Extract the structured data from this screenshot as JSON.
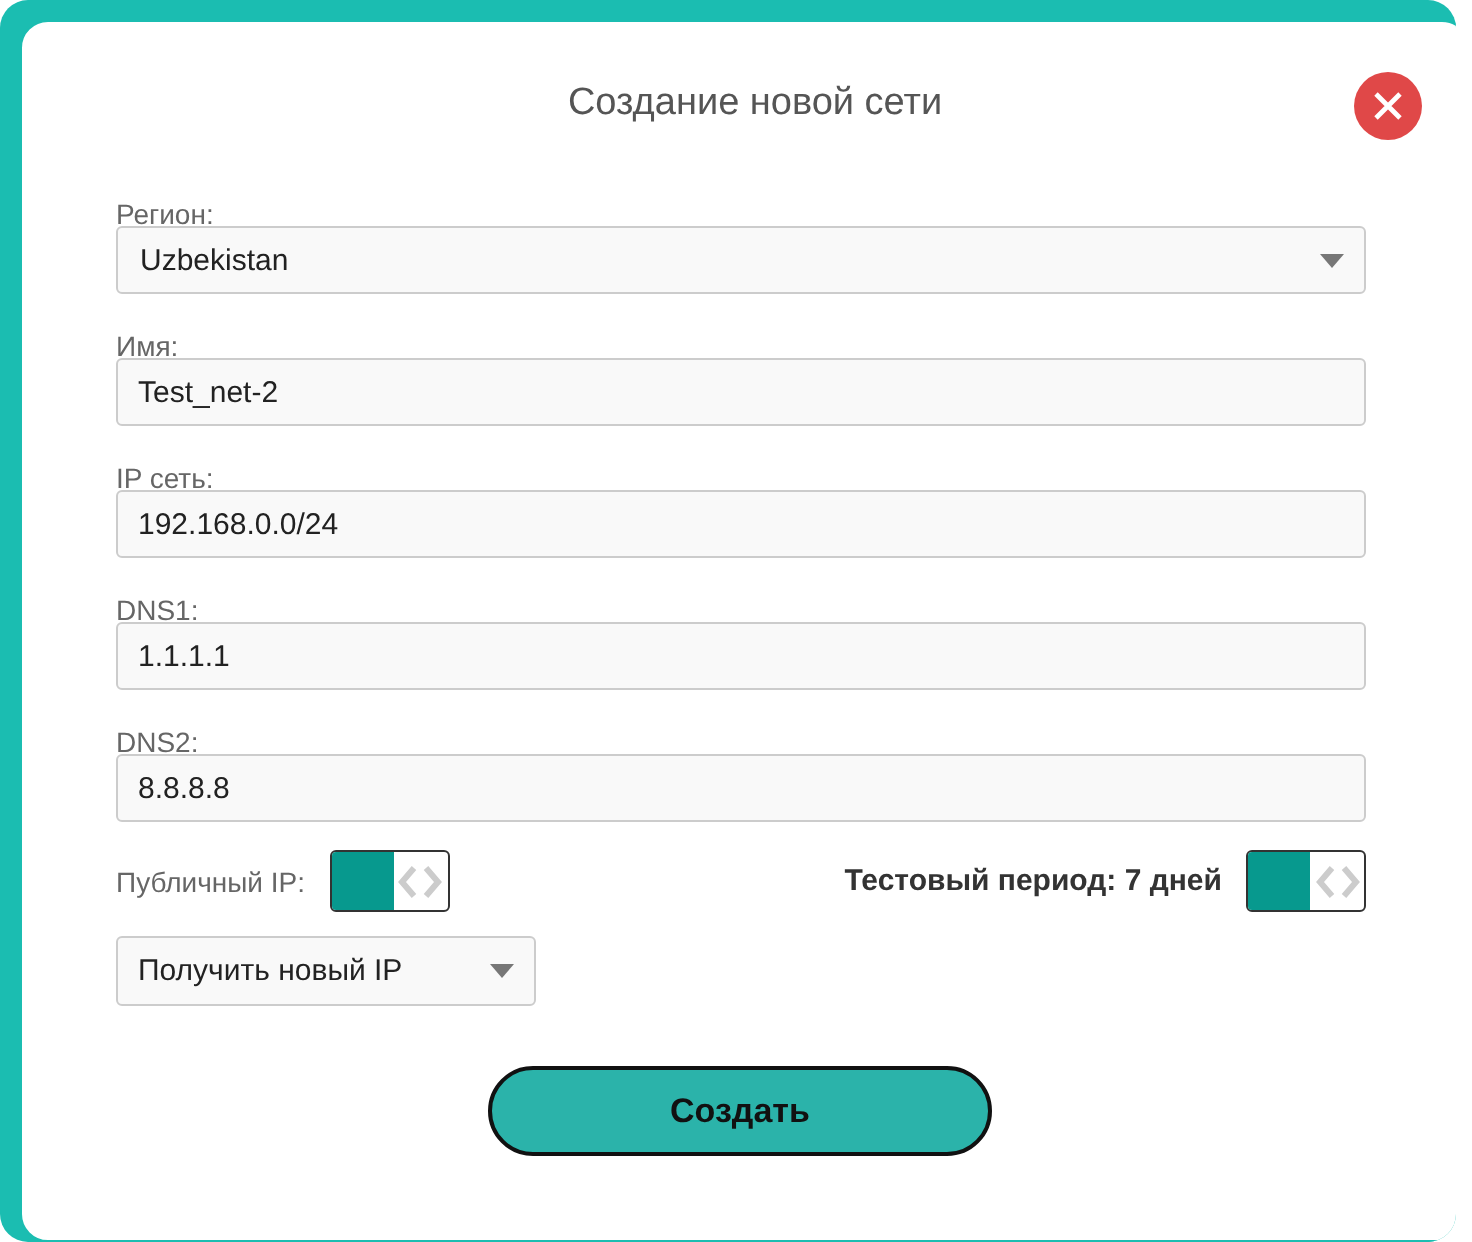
{
  "dialog": {
    "title": "Создание новой сети"
  },
  "fields": [
    {
      "kind": "select",
      "label": "Регион:",
      "value": "Uzbekistan"
    },
    {
      "kind": "text",
      "label": "Имя:",
      "value": "Test_net-2"
    },
    {
      "kind": "text",
      "label": "IP сеть:",
      "value": "192.168.0.0/24"
    },
    {
      "kind": "text",
      "label": "DNS1:",
      "value": "1.1.1.1"
    },
    {
      "kind": "text",
      "label": "DNS2:",
      "value": "8.8.8.8"
    }
  ],
  "public_ip": {
    "label": "Публичный IP:",
    "on": true
  },
  "trial": {
    "label": "Тестовый период: 7 дней",
    "on": true
  },
  "ip_select": {
    "value": "Получить новый IP"
  },
  "submit": {
    "label": "Создать"
  }
}
